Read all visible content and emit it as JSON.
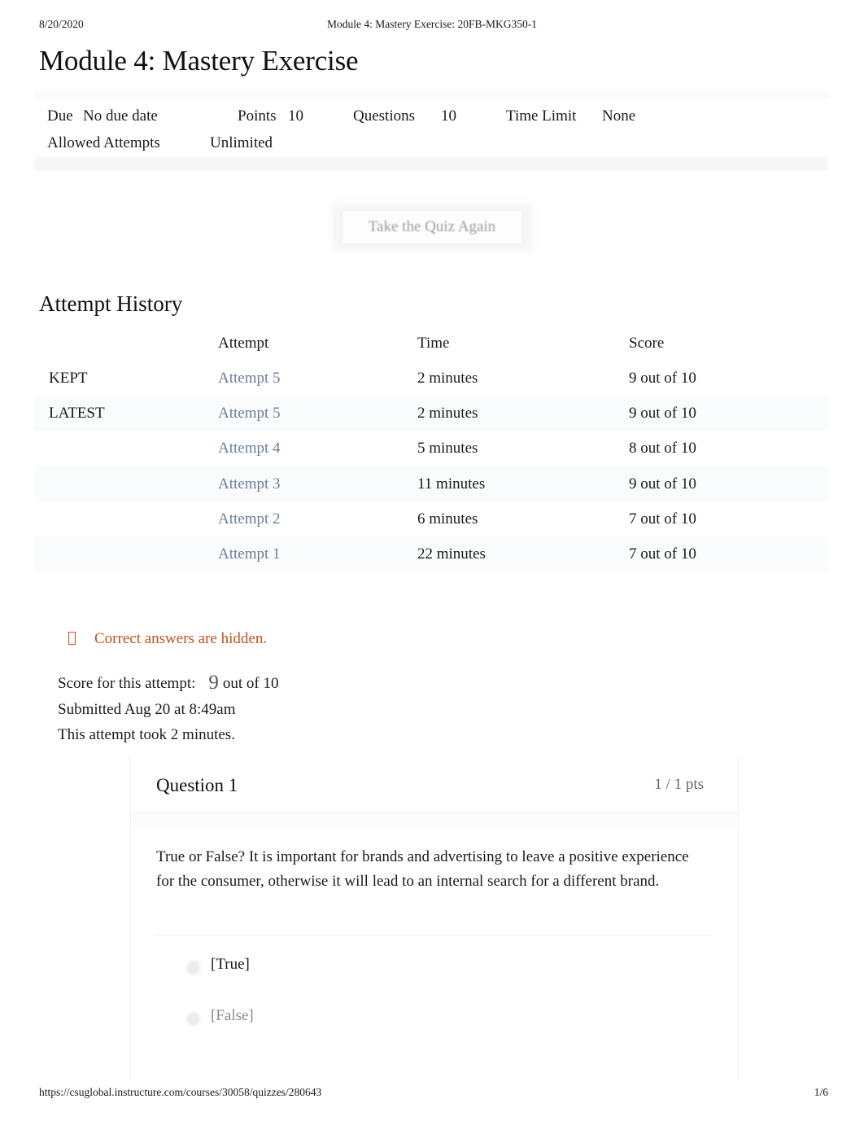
{
  "print_header": {
    "date": "8/20/2020",
    "title": "Module 4: Mastery Exercise: 20FB-MKG350-1"
  },
  "page": {
    "title": "Module 4: Mastery Exercise"
  },
  "meta": {
    "due_label": "Due",
    "due_value": "No due date",
    "points_label": "Points",
    "points_value": "10",
    "questions_label": "Questions",
    "questions_value": "10",
    "time_limit_label": "Time Limit",
    "time_limit_value": "None",
    "allowed_attempts_label": "Allowed Attempts",
    "allowed_attempts_value": "Unlimited"
  },
  "actions": {
    "retake_label": "Take the Quiz Again"
  },
  "attempt_history": {
    "heading": "Attempt History",
    "columns": [
      "",
      "Attempt",
      "Time",
      "Score"
    ],
    "rows": [
      {
        "flag": "KEPT",
        "attempt": "Attempt 5",
        "time": "2 minutes",
        "score": "9 out of 10"
      },
      {
        "flag": "LATEST",
        "attempt": "Attempt 5",
        "time": "2 minutes",
        "score": "9 out of 10"
      },
      {
        "flag": "",
        "attempt": "Attempt 4",
        "time": "5 minutes",
        "score": "8 out of 10"
      },
      {
        "flag": "",
        "attempt": "Attempt 3",
        "time": "11 minutes",
        "score": "9 out of 10"
      },
      {
        "flag": "",
        "attempt": "Attempt 2",
        "time": "6 minutes",
        "score": "7 out of 10"
      },
      {
        "flag": "",
        "attempt": "Attempt 1",
        "time": "22 minutes",
        "score": "7 out of 10"
      }
    ]
  },
  "notice": {
    "icon": "missing-glyph-box-icon",
    "text": "Correct answers are hidden.",
    "color": "#c0501e"
  },
  "attempt_summary": {
    "score_label": "Score for this attempt:",
    "score_value": "9",
    "score_suffix": "out of 10",
    "submitted": "Submitted Aug 20 at 8:49am",
    "duration": "This attempt took 2 minutes."
  },
  "question": {
    "name": "Question 1",
    "points": "1 / 1 pts",
    "text": "True or False? It is important for brands and advertising to leave a positive experience for the consumer, otherwise it will lead to an internal search for a different brand.",
    "answers": [
      {
        "label": "[True]",
        "selected": true
      },
      {
        "label": "[False]",
        "selected": false
      }
    ]
  },
  "print_footer": {
    "url": "https://csuglobal.instructure.com/courses/30058/quizzes/280643",
    "page": "1/6"
  },
  "colors": {
    "link": "#6b7f99",
    "notice": "#c0501e",
    "muted": "#8a8a8a"
  }
}
